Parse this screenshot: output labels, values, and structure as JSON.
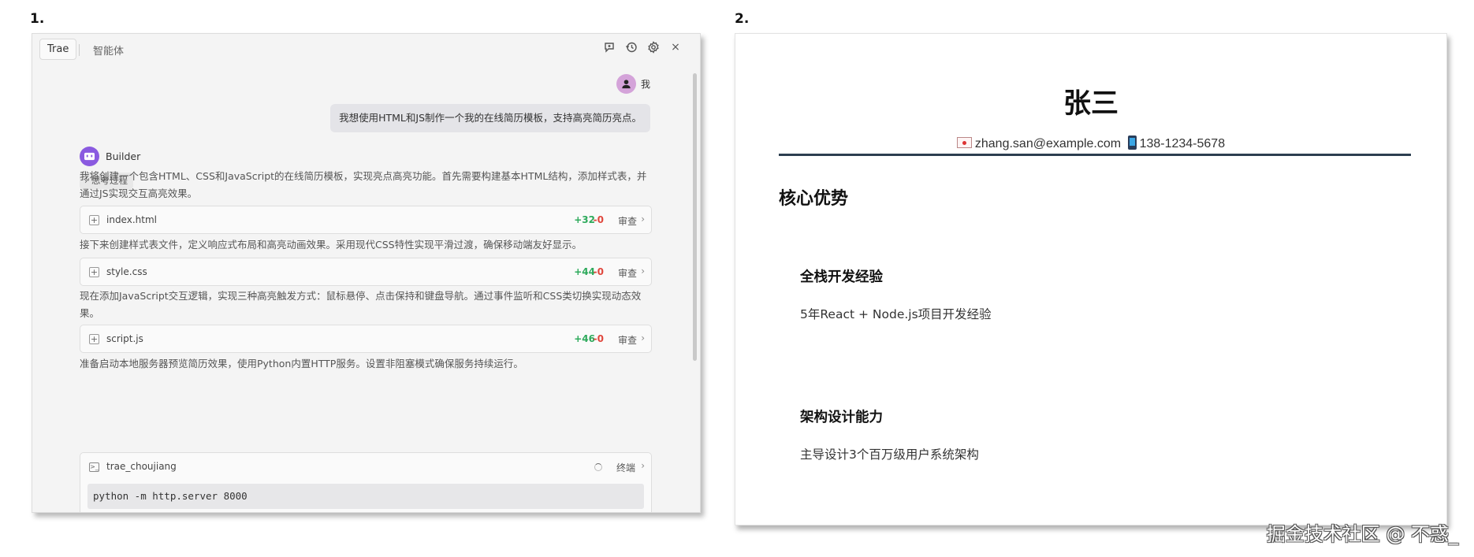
{
  "labels": {
    "panel1": "1.",
    "panel2": "2."
  },
  "chat": {
    "tab_trae": "Trae",
    "tab_agent": "智能体",
    "icons": [
      "new-chat-icon",
      "history-icon",
      "settings-icon",
      "close-icon"
    ],
    "close_glyph": "×",
    "user": {
      "name": "我",
      "message": "我想使用HTML和JS制作一个我的在线简历模板，支持高亮简历亮点。"
    },
    "bot": {
      "name": "Builder",
      "think_label": "思考过程"
    },
    "paragraphs": [
      "我将创建一个包含HTML、CSS和JavaScript的在线简历模板，实现亮点高亮功能。首先需要构建基本HTML结构，添加样式表，并通过JS实现交互高亮效果。",
      "接下来创建样式表文件，定义响应式布局和高亮动画效果。采用现代CSS特性实现平滑过渡，确保移动端友好显示。",
      "现在添加JavaScript交互逻辑，实现三种高亮触发方式：鼠标悬停、点击保持和键盘导航。通过事件监听和CSS类切换实现动态效果。",
      "准备启动本地服务器预览简历效果，使用Python内置HTTP服务。设置非阻塞模式确保服务持续运行。"
    ],
    "files": [
      {
        "name": "index.html",
        "added": "+32",
        "removed": "-0",
        "review": "审查"
      },
      {
        "name": "style.css",
        "added": "+44",
        "removed": "-0",
        "review": "审查"
      },
      {
        "name": "script.js",
        "added": "+46",
        "removed": "-0",
        "review": "审查"
      }
    ],
    "terminal": {
      "name": "trae_choujiang",
      "status": "终端",
      "command": "python -m http.server 8000"
    },
    "colors": {
      "added": "#2eaa5c",
      "removed": "#e0473d",
      "bot_avatar": "#8a5ae0"
    }
  },
  "resume": {
    "name": "张三",
    "email": "zhang.san@example.com",
    "phone": "138-1234-5678",
    "section_title": "核心优势",
    "items": [
      {
        "title": "全栈开发经验",
        "desc": "5年React + Node.js项目开发经验"
      },
      {
        "title": "架构设计能力",
        "desc": "主导设计3个百万级用户系统架构"
      }
    ],
    "rule_color": "#2c3e50"
  },
  "watermark": "掘金技术社区 @ 不惑_"
}
